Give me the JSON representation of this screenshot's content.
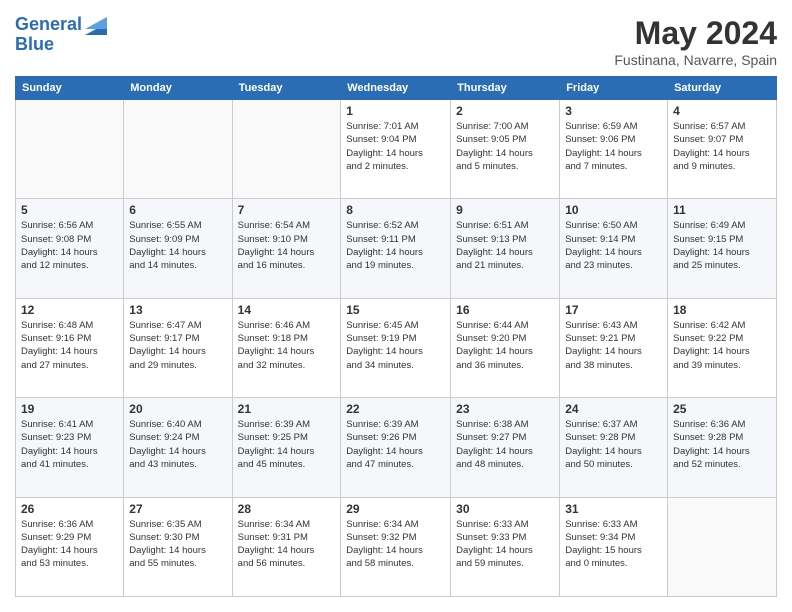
{
  "header": {
    "logo_line1": "General",
    "logo_line2": "Blue",
    "month_title": "May 2024",
    "location": "Fustinana, Navarre, Spain"
  },
  "weekdays": [
    "Sunday",
    "Monday",
    "Tuesday",
    "Wednesday",
    "Thursday",
    "Friday",
    "Saturday"
  ],
  "weeks": [
    [
      {
        "day": "",
        "info": ""
      },
      {
        "day": "",
        "info": ""
      },
      {
        "day": "",
        "info": ""
      },
      {
        "day": "1",
        "info": "Sunrise: 7:01 AM\nSunset: 9:04 PM\nDaylight: 14 hours\nand 2 minutes."
      },
      {
        "day": "2",
        "info": "Sunrise: 7:00 AM\nSunset: 9:05 PM\nDaylight: 14 hours\nand 5 minutes."
      },
      {
        "day": "3",
        "info": "Sunrise: 6:59 AM\nSunset: 9:06 PM\nDaylight: 14 hours\nand 7 minutes."
      },
      {
        "day": "4",
        "info": "Sunrise: 6:57 AM\nSunset: 9:07 PM\nDaylight: 14 hours\nand 9 minutes."
      }
    ],
    [
      {
        "day": "5",
        "info": "Sunrise: 6:56 AM\nSunset: 9:08 PM\nDaylight: 14 hours\nand 12 minutes."
      },
      {
        "day": "6",
        "info": "Sunrise: 6:55 AM\nSunset: 9:09 PM\nDaylight: 14 hours\nand 14 minutes."
      },
      {
        "day": "7",
        "info": "Sunrise: 6:54 AM\nSunset: 9:10 PM\nDaylight: 14 hours\nand 16 minutes."
      },
      {
        "day": "8",
        "info": "Sunrise: 6:52 AM\nSunset: 9:11 PM\nDaylight: 14 hours\nand 19 minutes."
      },
      {
        "day": "9",
        "info": "Sunrise: 6:51 AM\nSunset: 9:13 PM\nDaylight: 14 hours\nand 21 minutes."
      },
      {
        "day": "10",
        "info": "Sunrise: 6:50 AM\nSunset: 9:14 PM\nDaylight: 14 hours\nand 23 minutes."
      },
      {
        "day": "11",
        "info": "Sunrise: 6:49 AM\nSunset: 9:15 PM\nDaylight: 14 hours\nand 25 minutes."
      }
    ],
    [
      {
        "day": "12",
        "info": "Sunrise: 6:48 AM\nSunset: 9:16 PM\nDaylight: 14 hours\nand 27 minutes."
      },
      {
        "day": "13",
        "info": "Sunrise: 6:47 AM\nSunset: 9:17 PM\nDaylight: 14 hours\nand 29 minutes."
      },
      {
        "day": "14",
        "info": "Sunrise: 6:46 AM\nSunset: 9:18 PM\nDaylight: 14 hours\nand 32 minutes."
      },
      {
        "day": "15",
        "info": "Sunrise: 6:45 AM\nSunset: 9:19 PM\nDaylight: 14 hours\nand 34 minutes."
      },
      {
        "day": "16",
        "info": "Sunrise: 6:44 AM\nSunset: 9:20 PM\nDaylight: 14 hours\nand 36 minutes."
      },
      {
        "day": "17",
        "info": "Sunrise: 6:43 AM\nSunset: 9:21 PM\nDaylight: 14 hours\nand 38 minutes."
      },
      {
        "day": "18",
        "info": "Sunrise: 6:42 AM\nSunset: 9:22 PM\nDaylight: 14 hours\nand 39 minutes."
      }
    ],
    [
      {
        "day": "19",
        "info": "Sunrise: 6:41 AM\nSunset: 9:23 PM\nDaylight: 14 hours\nand 41 minutes."
      },
      {
        "day": "20",
        "info": "Sunrise: 6:40 AM\nSunset: 9:24 PM\nDaylight: 14 hours\nand 43 minutes."
      },
      {
        "day": "21",
        "info": "Sunrise: 6:39 AM\nSunset: 9:25 PM\nDaylight: 14 hours\nand 45 minutes."
      },
      {
        "day": "22",
        "info": "Sunrise: 6:39 AM\nSunset: 9:26 PM\nDaylight: 14 hours\nand 47 minutes."
      },
      {
        "day": "23",
        "info": "Sunrise: 6:38 AM\nSunset: 9:27 PM\nDaylight: 14 hours\nand 48 minutes."
      },
      {
        "day": "24",
        "info": "Sunrise: 6:37 AM\nSunset: 9:28 PM\nDaylight: 14 hours\nand 50 minutes."
      },
      {
        "day": "25",
        "info": "Sunrise: 6:36 AM\nSunset: 9:28 PM\nDaylight: 14 hours\nand 52 minutes."
      }
    ],
    [
      {
        "day": "26",
        "info": "Sunrise: 6:36 AM\nSunset: 9:29 PM\nDaylight: 14 hours\nand 53 minutes."
      },
      {
        "day": "27",
        "info": "Sunrise: 6:35 AM\nSunset: 9:30 PM\nDaylight: 14 hours\nand 55 minutes."
      },
      {
        "day": "28",
        "info": "Sunrise: 6:34 AM\nSunset: 9:31 PM\nDaylight: 14 hours\nand 56 minutes."
      },
      {
        "day": "29",
        "info": "Sunrise: 6:34 AM\nSunset: 9:32 PM\nDaylight: 14 hours\nand 58 minutes."
      },
      {
        "day": "30",
        "info": "Sunrise: 6:33 AM\nSunset: 9:33 PM\nDaylight: 14 hours\nand 59 minutes."
      },
      {
        "day": "31",
        "info": "Sunrise: 6:33 AM\nSunset: 9:34 PM\nDaylight: 15 hours\nand 0 minutes."
      },
      {
        "day": "",
        "info": ""
      }
    ]
  ]
}
